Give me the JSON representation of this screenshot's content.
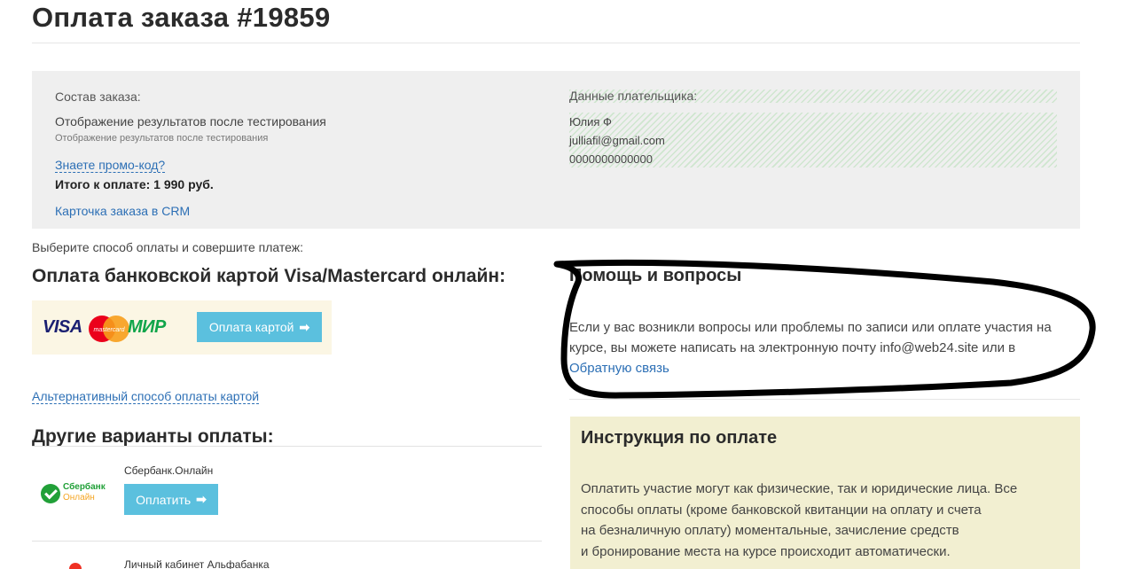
{
  "header": {
    "title": "Оплата заказа #19859"
  },
  "order": {
    "composition_label": "Состав заказа:",
    "item_title": "Отображение результатов после тестирования",
    "item_subtitle": "Отображение результатов после тестирования",
    "promo_link": "Знаете промо-код?",
    "total_label": "Итого к оплате:",
    "total_value": "1 990 руб.",
    "crm_link": "Карточка заказа в CRM"
  },
  "payer": {
    "label": "Данные плательщика:",
    "name": "Юлия Ф",
    "email": "julliafil@gmail.com",
    "phone": "0000000000000"
  },
  "payment": {
    "choose_text": "Выберите способ оплаты и совершите платеж:",
    "card_heading": "Оплата банковской картой Visa/Mastercard онлайн:",
    "card_logos": {
      "visa": "VISA",
      "mastercard": "mastercard",
      "mir": "МИР"
    },
    "card_button": "Оплата картой",
    "alt_link": "Альтернативный способ оплаты картой",
    "other_heading": "Другие варианты оплаты:",
    "sber": {
      "logo_line1": "Сбербанк",
      "logo_line2": "Онлайн",
      "title": "Сбербанк.Онлайн",
      "button": "Оплатить"
    },
    "alfa": {
      "title": "Личный кабинет Альфабанка"
    }
  },
  "help": {
    "heading": "Помощь и вопросы",
    "text": "Если у вас возникли вопросы или проблемы по записи или оплате участия на курсе, вы можете написать на электронную почту info@web24.site или в",
    "link": "Обратную связь"
  },
  "instructions": {
    "heading": "Инструкция по оплате",
    "line1": "Оплатить участие могут как физические, так и юридические лица. Все",
    "line2": "способы оплаты (кроме банковской квитанции на оплату и счета",
    "line3": "на безналичную оплату) моментальные, зачисление средств",
    "line4": "и бронирование места на курсе происходит автоматически."
  },
  "icons": {
    "arrow": "arrow-right-icon"
  },
  "colors": {
    "accent_button": "#5bc0de",
    "link": "#2c6fb5",
    "instruction_bg": "#f2efd1",
    "order_bg": "#efefef"
  }
}
